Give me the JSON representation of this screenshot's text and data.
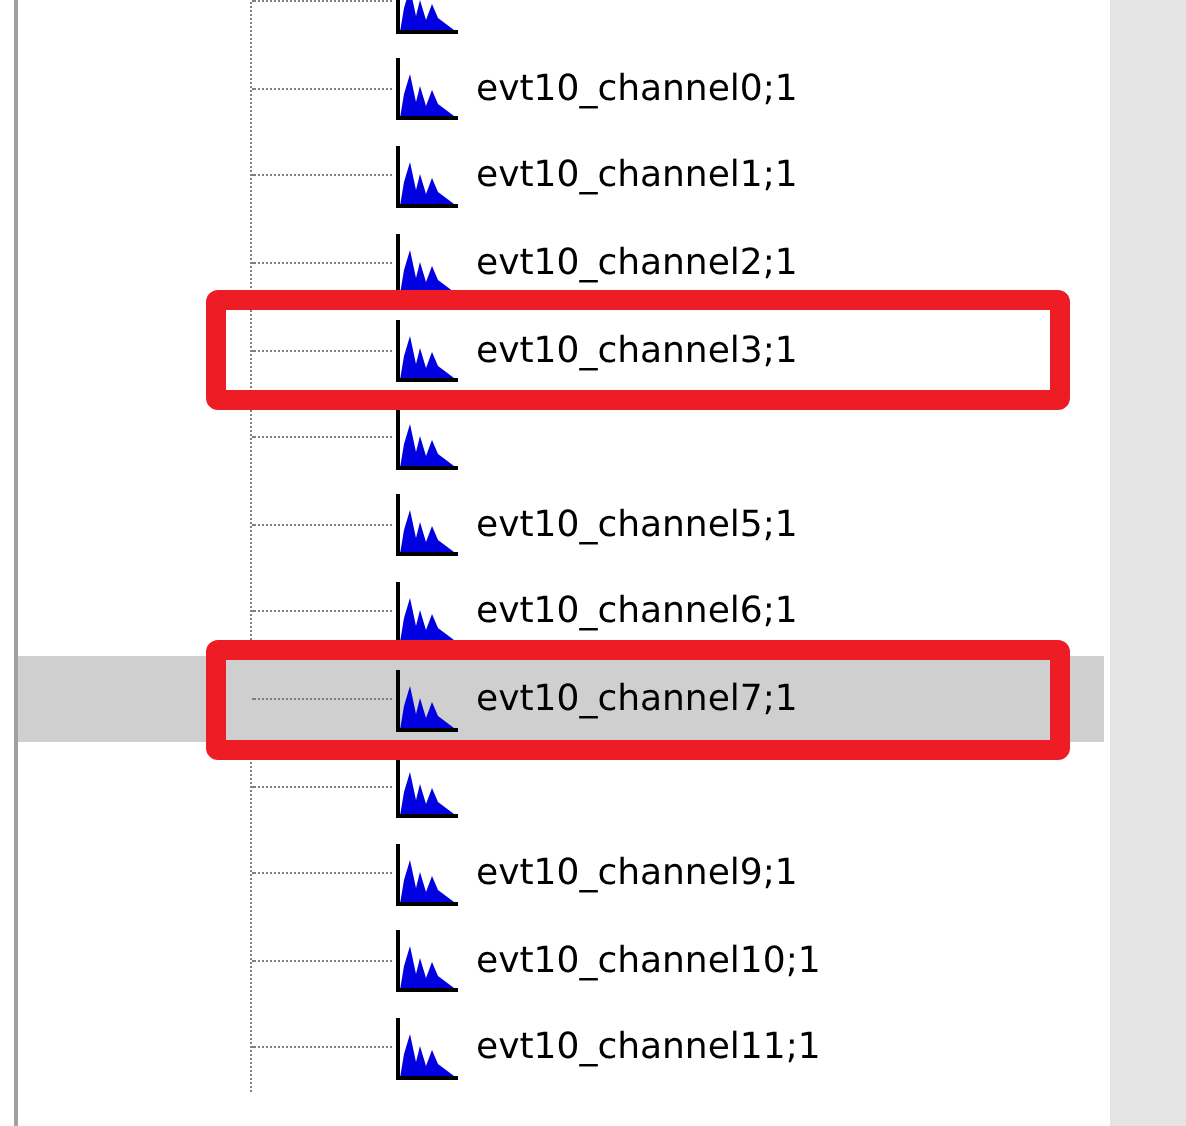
{
  "tree": {
    "items": [
      {
        "selected": false,
        "highlighted": false
      },
      {
        "label": "evt10_channel0;1",
        "selected": false,
        "highlighted": false
      },
      {
        "label": "evt10_channel1;1",
        "selected": false,
        "highlighted": false
      },
      {
        "label": "evt10_channel2;1",
        "selected": false,
        "highlighted": false
      },
      {
        "label": "evt10_channel3;1",
        "selected": false,
        "highlighted": true
      },
      {
        "selected": false,
        "highlighted": false
      },
      {
        "label": "evt10_channel5;1",
        "selected": false,
        "highlighted": false
      },
      {
        "label": "evt10_channel6;1",
        "selected": false,
        "highlighted": false
      },
      {
        "label": "evt10_channel7;1",
        "selected": true,
        "highlighted": true
      },
      {
        "selected": false,
        "highlighted": false
      },
      {
        "label": "evt10_channel9;1",
        "selected": false,
        "highlighted": false
      },
      {
        "label": "evt10_channel10;1",
        "selected": false,
        "highlighted": false
      },
      {
        "label": "evt10_channel11;1",
        "selected": false,
        "highlighted": false
      }
    ]
  }
}
